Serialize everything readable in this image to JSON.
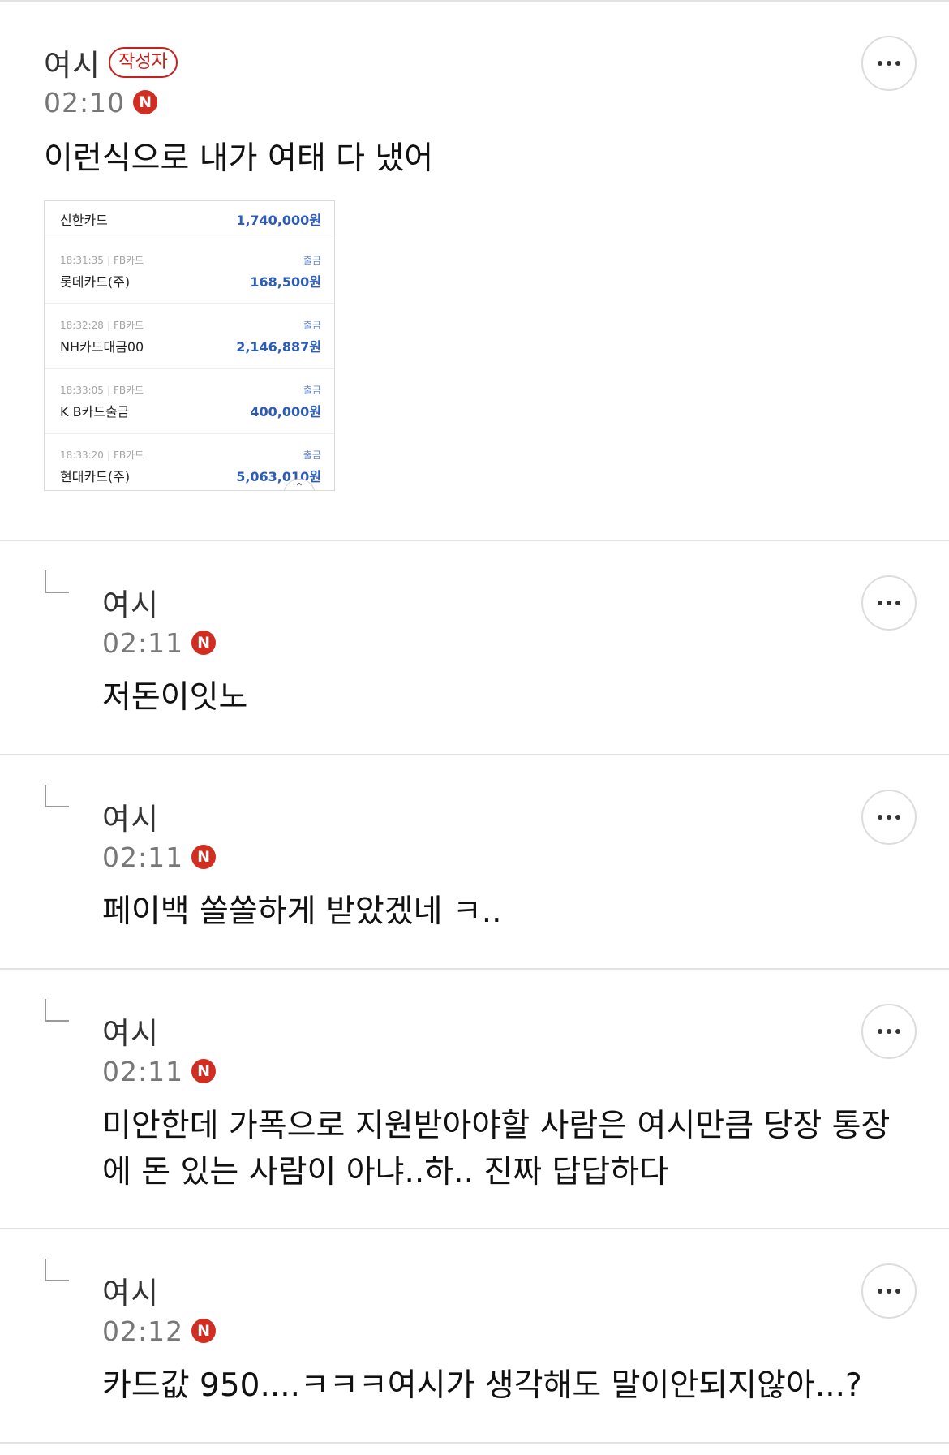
{
  "post_comment": {
    "author": "여시",
    "writer_badge": "작성자",
    "time": "02:10",
    "new_badge": "N",
    "text": "이런식으로 내가 여태 다 냈어",
    "attachment": {
      "header_name": "신한카드",
      "header_amount": "1,740,000원",
      "transactions": [
        {
          "time": "18:31:35",
          "category": "FB카드",
          "merchant": "롯데카드(주)",
          "type": "출금",
          "amount": "168,500원"
        },
        {
          "time": "18:32:28",
          "category": "FB카드",
          "merchant": "NH카드대금00",
          "type": "출금",
          "amount": "2,146,887원"
        },
        {
          "time": "18:33:05",
          "category": "FB카드",
          "merchant": "K B카드출금",
          "type": "출금",
          "amount": "400,000원"
        },
        {
          "time": "18:33:20",
          "category": "FB카드",
          "merchant": "현대카드(주)",
          "type": "출금",
          "amount": "5,063,010원"
        }
      ],
      "separator": "|",
      "scroll_top_glyph": "⌃"
    }
  },
  "replies": [
    {
      "author": "여시",
      "time": "02:11",
      "new_badge": "N",
      "text": "저돈이잇노"
    },
    {
      "author": "여시",
      "time": "02:11",
      "new_badge": "N",
      "text": "페이백 쏠쏠하게 받았겠네 ㅋ.."
    },
    {
      "author": "여시",
      "time": "02:11",
      "new_badge": "N",
      "text": "미안한데 가폭으로 지원받아야할 사람은 여시만큼 당장 통장\n에 돈 있는 사람이 아냐..하.. 진짜 답답하다"
    },
    {
      "author": "여시",
      "time": "02:12",
      "new_badge": "N",
      "text": "카드값 950....ㅋㅋㅋ여시가 생각해도 말이안되지않아...?"
    }
  ],
  "colors": {
    "accent_red": "#d12d20",
    "divider": "#e3e3e3",
    "amount_blue": "#2d5bb8"
  },
  "icons": {
    "more": "more-horizontal-icon",
    "reply": "reply-arrow-icon",
    "scroll_top": "scroll-top-icon"
  }
}
